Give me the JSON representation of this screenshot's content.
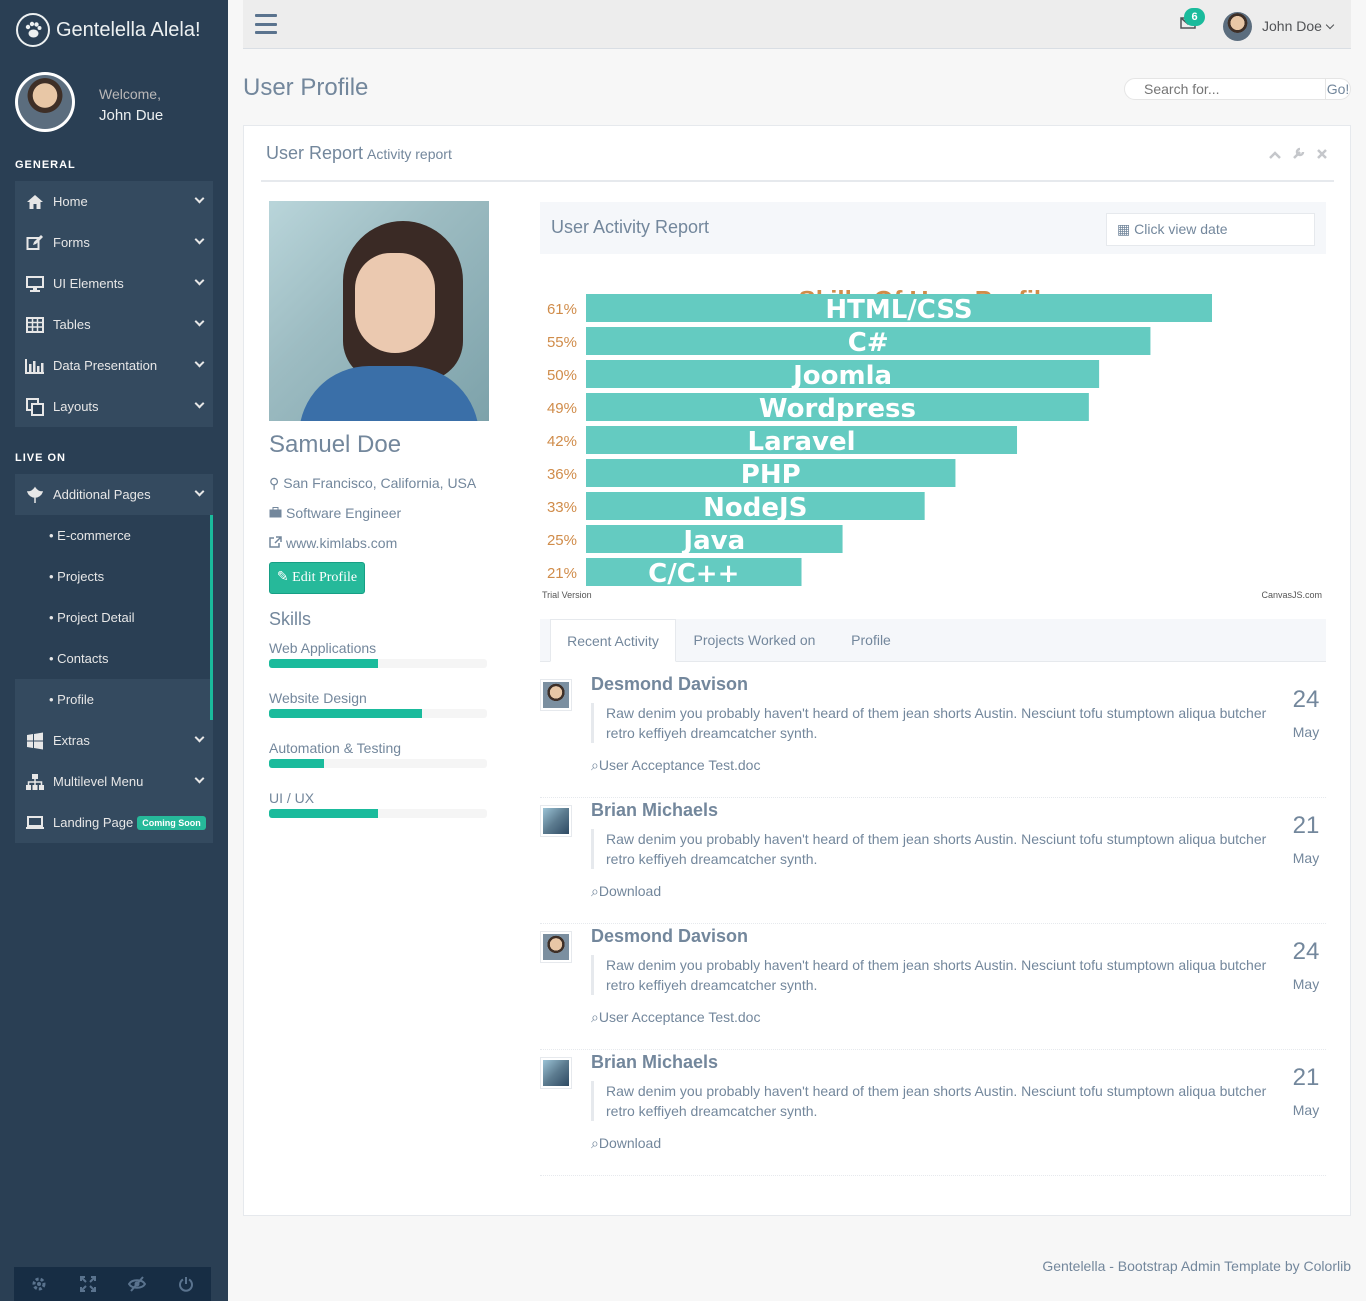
{
  "sidebar": {
    "brand": "Gentelella Alela!",
    "welcome": "Welcome,",
    "user_name": "John Due",
    "sections": {
      "general": "GENERAL",
      "live_on": "LIVE ON"
    },
    "general_items": [
      {
        "label": "Home",
        "icon": "home-icon"
      },
      {
        "label": "Forms",
        "icon": "edit-icon"
      },
      {
        "label": "UI Elements",
        "icon": "desktop-icon"
      },
      {
        "label": "Tables",
        "icon": "table-icon"
      },
      {
        "label": "Data Presentation",
        "icon": "bar-chart-icon"
      },
      {
        "label": "Layouts",
        "icon": "clone-icon"
      }
    ],
    "additional_pages": {
      "label": "Additional Pages",
      "icon": "bug-icon"
    },
    "sub_items": [
      "E-commerce",
      "Projects",
      "Project Detail",
      "Contacts",
      "Profile"
    ],
    "extras": {
      "label": "Extras",
      "icon": "windows-icon"
    },
    "multilevel": {
      "label": "Multilevel Menu",
      "icon": "sitemap-icon"
    },
    "landing": {
      "label": "Landing Page",
      "icon": "laptop-icon",
      "badge": "Coming Soon"
    },
    "footer_icons": [
      "settings-icon",
      "fullscreen-icon",
      "lock-icon",
      "logout-icon"
    ]
  },
  "topnav": {
    "mail_count": "6",
    "user_name": "John Doe"
  },
  "page": {
    "title": "User Profile",
    "search_placeholder": "Search for...",
    "search_button": "Go!"
  },
  "panel": {
    "title": "User Report",
    "subtitle": "Activity report"
  },
  "profile": {
    "name": "Samuel Doe",
    "location": "San Francisco, California, USA",
    "job": "Software Engineer",
    "website": "www.kimlabs.com",
    "edit_button": "Edit Profile",
    "skills_title": "Skills",
    "skills": [
      {
        "label": "Web Applications",
        "value": 50
      },
      {
        "label": "Website Design",
        "value": 70
      },
      {
        "label": "Automation & Testing",
        "value": 25
      },
      {
        "label": "UI / UX",
        "value": 50
      }
    ]
  },
  "chart_header": {
    "title": "User Activity Report",
    "date_button": "Click view date"
  },
  "chart_data": {
    "type": "bar",
    "title": "Skills Of User Profile",
    "orientation": "horizontal",
    "categories": [
      "HTML/CSS",
      "C#",
      "Joomla",
      "Wordpress",
      "Laravel",
      "PHP",
      "NodeJS",
      "Java",
      "C/C++"
    ],
    "values": [
      61,
      55,
      50,
      49,
      42,
      36,
      33,
      25,
      21
    ],
    "value_suffix": "%",
    "bar_color": "#64CBC1",
    "label_color": "#D08C4A",
    "credit_left": "Trial Version",
    "credit_right": "CanvasJS.com"
  },
  "tabs": [
    "Recent Activity",
    "Projects Worked on",
    "Profile"
  ],
  "activities": [
    {
      "name": "Desmond Davison",
      "avatar": "avatar-desmond",
      "text": "Raw denim you probably haven't heard of them jean shorts Austin. Nesciunt tofu stumptown aliqua butcher retro keffiyeh dreamcatcher synth.",
      "day": "24",
      "month": "May",
      "file": "User Acceptance Test.doc"
    },
    {
      "name": "Brian Michaels",
      "avatar": "avatar-brian",
      "text": "Raw denim you probably haven't heard of them jean shorts Austin. Nesciunt tofu stumptown aliqua butcher retro keffiyeh dreamcatcher synth.",
      "day": "21",
      "month": "May",
      "file": "Download"
    },
    {
      "name": "Desmond Davison",
      "avatar": "avatar-desmond",
      "text": "Raw denim you probably haven't heard of them jean shorts Austin. Nesciunt tofu stumptown aliqua butcher retro keffiyeh dreamcatcher synth.",
      "day": "24",
      "month": "May",
      "file": "User Acceptance Test.doc"
    },
    {
      "name": "Brian Michaels",
      "avatar": "avatar-brian",
      "text": "Raw denim you probably haven't heard of them jean shorts Austin. Nesciunt tofu stumptown aliqua butcher retro keffiyeh dreamcatcher synth.",
      "day": "21",
      "month": "May",
      "file": "Download"
    }
  ],
  "footer": "Gentelella - Bootstrap Admin Template by Colorlib"
}
